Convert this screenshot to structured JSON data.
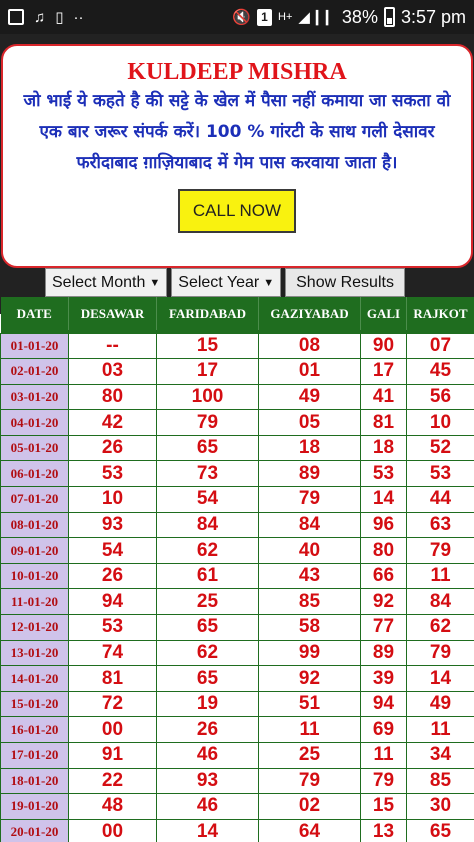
{
  "status_bar": {
    "battery_percent": "38%",
    "time": "3:57 pm",
    "sim_badge": "1",
    "network": "H+",
    "more": "··"
  },
  "promo": {
    "title": "KULDEEP MISHRA",
    "text": "जो भाई ये कहते है की सट्टे के खेल में पैसा नहीं कमाया जा सकता वो एक बार जरूर संपर्क करें। 100 % गांरटी के साथ गली देसावर फरीदाबाद ग़ाज़ियाबाद में गेम पास करवाया जाता है।",
    "call_button": "CALL NOW",
    "colors": {
      "title": "#e0141a",
      "text": "#1c2fb8",
      "button_bg": "#f9f20f",
      "border": "#d9262b"
    }
  },
  "filters": {
    "month_select": "Select Month",
    "year_select": "Select Year",
    "show_button": "Show Results"
  },
  "table": {
    "headers": [
      "DATE",
      "DESAWAR",
      "FARIDABAD",
      "GAZIYABAD",
      "GALI",
      "RAJKOT"
    ],
    "rows": [
      [
        "01-01-20",
        "--",
        "15",
        "08",
        "90",
        "07"
      ],
      [
        "02-01-20",
        "03",
        "17",
        "01",
        "17",
        "45"
      ],
      [
        "03-01-20",
        "80",
        "100",
        "49",
        "41",
        "56"
      ],
      [
        "04-01-20",
        "42",
        "79",
        "05",
        "81",
        "10"
      ],
      [
        "05-01-20",
        "26",
        "65",
        "18",
        "18",
        "52"
      ],
      [
        "06-01-20",
        "53",
        "73",
        "89",
        "53",
        "53"
      ],
      [
        "07-01-20",
        "10",
        "54",
        "79",
        "14",
        "44"
      ],
      [
        "08-01-20",
        "93",
        "84",
        "84",
        "96",
        "63"
      ],
      [
        "09-01-20",
        "54",
        "62",
        "40",
        "80",
        "79"
      ],
      [
        "10-01-20",
        "26",
        "61",
        "43",
        "66",
        "11"
      ],
      [
        "11-01-20",
        "94",
        "25",
        "85",
        "92",
        "84"
      ],
      [
        "12-01-20",
        "53",
        "65",
        "58",
        "77",
        "62"
      ],
      [
        "13-01-20",
        "74",
        "62",
        "99",
        "89",
        "79"
      ],
      [
        "14-01-20",
        "81",
        "65",
        "92",
        "39",
        "14"
      ],
      [
        "15-01-20",
        "72",
        "19",
        "51",
        "94",
        "49"
      ],
      [
        "16-01-20",
        "00",
        "26",
        "11",
        "69",
        "11"
      ],
      [
        "17-01-20",
        "91",
        "46",
        "25",
        "11",
        "34"
      ],
      [
        "18-01-20",
        "22",
        "93",
        "79",
        "79",
        "85"
      ],
      [
        "19-01-20",
        "48",
        "46",
        "02",
        "15",
        "30"
      ],
      [
        "20-01-20",
        "00",
        "14",
        "64",
        "13",
        "65"
      ]
    ],
    "colors": {
      "header_bg": "#1f6d1f",
      "date_bg": "#cfc3ea",
      "value": "#d40d12"
    }
  }
}
